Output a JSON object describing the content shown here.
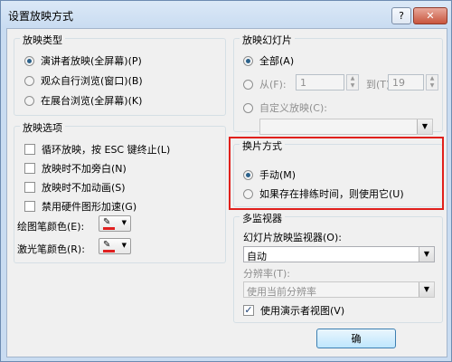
{
  "window": {
    "title": "设置放映方式"
  },
  "show_type": {
    "title": "放映类型",
    "options": [
      {
        "label": "演讲者放映(全屏幕)(P)",
        "selected": true
      },
      {
        "label": "观众自行浏览(窗口)(B)",
        "selected": false
      },
      {
        "label": "在展台浏览(全屏幕)(K)",
        "selected": false
      }
    ]
  },
  "show_options": {
    "title": "放映选项",
    "checks": [
      {
        "label": "循环放映，按 ESC 键终止(L)",
        "checked": false
      },
      {
        "label": "放映时不加旁白(N)",
        "checked": false
      },
      {
        "label": "放映时不加动画(S)",
        "checked": false
      },
      {
        "label": "禁用硬件图形加速(G)",
        "checked": false
      }
    ],
    "pen_color_label": "绘图笔颜色(E):",
    "laser_color_label": "激光笔颜色(R):",
    "pen_color": "#e02020",
    "laser_color": "#e02020"
  },
  "slides": {
    "title": "放映幻灯片",
    "all_label": "全部(A)",
    "from_label": "从(F):",
    "from_value": "1",
    "to_label": "到(T):",
    "to_value": "19",
    "custom_label": "自定义放映(C):",
    "custom_value": ""
  },
  "advance": {
    "title": "换片方式",
    "options": [
      {
        "label": "手动(M)",
        "selected": true
      },
      {
        "label": "如果存在排练时间，则使用它(U)",
        "selected": false
      }
    ],
    "highlight_color": "#e0201c"
  },
  "monitors": {
    "title": "多监视器",
    "monitor_label": "幻灯片放映监视器(O):",
    "monitor_value": "自动",
    "resolution_label": "分辨率(T):",
    "resolution_value": "使用当前分辨率",
    "presenter_view_label": "使用演示者视图(V)",
    "presenter_view_checked": true
  },
  "buttons": {
    "ok_label": "确"
  }
}
